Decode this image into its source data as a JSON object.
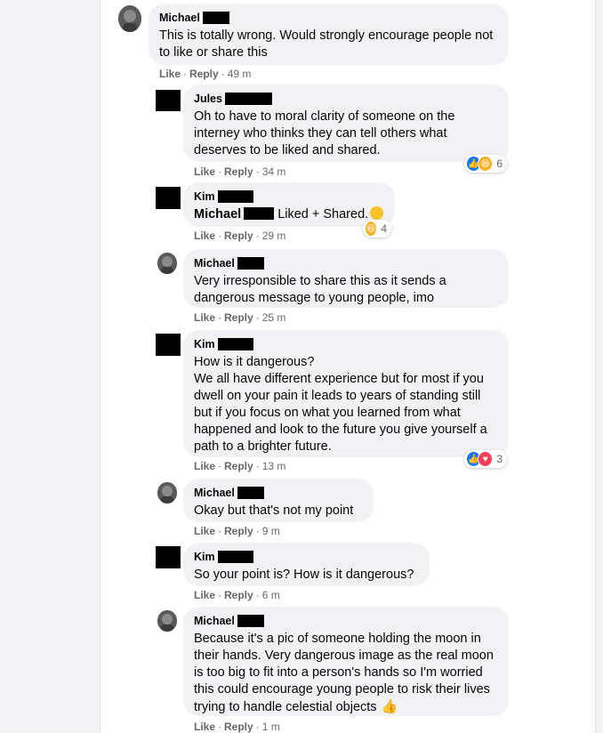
{
  "comments": [
    {
      "author": "Michael",
      "text": "This is totally wrong. Would strongly encourage people not to like or share this",
      "actions": {
        "like": "Like",
        "reply": "Reply",
        "time": "49 m"
      }
    },
    {
      "author": "Jules",
      "text": "Oh to have to moral clarity of someone on the interney who thinks they can tell others what deserves to be liked and shared.",
      "actions": {
        "like": "Like",
        "reply": "Reply",
        "time": "34 m"
      },
      "reactions": {
        "count": "6",
        "types": [
          "like-icon",
          "haha-icon"
        ]
      }
    },
    {
      "author": "Kim",
      "mention": "Michael",
      "text": "Liked + Shared.",
      "emoji": "grinning-face-icon",
      "actions": {
        "like": "Like",
        "reply": "Reply",
        "time": "29 m"
      },
      "reactions": {
        "count": "4",
        "types": [
          "haha-icon"
        ]
      }
    },
    {
      "author": "Michael",
      "text": "Very irresponsible to share this as it sends a dangerous message to young people, imo",
      "actions": {
        "like": "Like",
        "reply": "Reply",
        "time": "25 m"
      }
    },
    {
      "author": "Kim",
      "text": "How is it dangerous?\nWe all have different experience but for most if you dwell on your pain it leads to years of standing still but if you focus on what you learned from what happened and look to the future you give yourself a path to a brighter future.",
      "actions": {
        "like": "Like",
        "reply": "Reply",
        "time": "13 m"
      },
      "reactions": {
        "count": "3",
        "types": [
          "like-icon",
          "love-icon"
        ]
      }
    },
    {
      "author": "Michael",
      "text": "Okay but that's not my point",
      "actions": {
        "like": "Like",
        "reply": "Reply",
        "time": "9 m"
      }
    },
    {
      "author": "Kim",
      "text": "So your point is? How is it dangerous?",
      "actions": {
        "like": "Like",
        "reply": "Reply",
        "time": "6 m"
      }
    },
    {
      "author": "Michael",
      "text": "Because it's a pic of someone holding the moon in their hands. Very dangerous image as the real moon is too big to fit into a person's hands so I'm worried this could encourage young people to risk their lives trying to handle celestial objects",
      "emoji": "thumbs-up-icon",
      "actions": {
        "like": "Like",
        "reply": "Reply",
        "time": "1 m"
      }
    }
  ],
  "colors": {
    "bubble": "#f0f2f5",
    "like": "#1877f2",
    "love": "#f33e58",
    "haha": "#f7b125",
    "meta": "#65676b"
  }
}
